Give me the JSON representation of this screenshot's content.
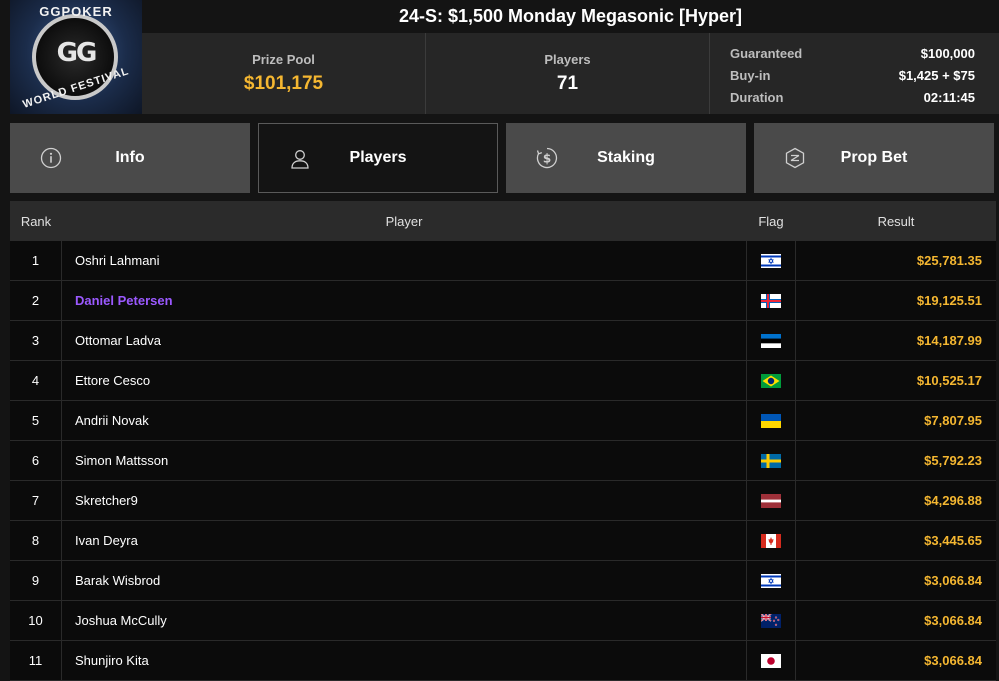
{
  "logo": {
    "top_text": "GGPOKER",
    "bottom_text": "WORLD FESTIVAL",
    "mark": "GG"
  },
  "header": {
    "title": "24-S: $1,500 Monday Megasonic [Hyper]",
    "prize_pool_label": "Prize Pool",
    "prize_pool_value": "$101,175",
    "players_label": "Players",
    "players_value": "71",
    "details": [
      {
        "label": "Guaranteed",
        "value": "$100,000"
      },
      {
        "label": "Buy-in",
        "value": "$1,425 + $75"
      },
      {
        "label": "Duration",
        "value": "02:11:45"
      }
    ]
  },
  "tabs": [
    {
      "label": "Info",
      "icon": "info-icon",
      "active": false
    },
    {
      "label": "Players",
      "icon": "user-icon",
      "active": true
    },
    {
      "label": "Staking",
      "icon": "dollar-icon",
      "active": false
    },
    {
      "label": "Prop Bet",
      "icon": "prop-bet-icon",
      "active": false
    }
  ],
  "table": {
    "headers": {
      "rank": "Rank",
      "player": "Player",
      "flag": "Flag",
      "result": "Result"
    },
    "rows": [
      {
        "rank": "1",
        "player": "Oshri Lahmani",
        "flag": "israel",
        "result": "$25,781.35"
      },
      {
        "rank": "2",
        "player": "Daniel Petersen",
        "flag": "faroe-islands",
        "result": "$19,125.51",
        "highlight": true
      },
      {
        "rank": "3",
        "player": "Ottomar Ladva",
        "flag": "estonia",
        "result": "$14,187.99"
      },
      {
        "rank": "4",
        "player": "Ettore Cesco",
        "flag": "brazil",
        "result": "$10,525.17"
      },
      {
        "rank": "5",
        "player": "Andrii Novak",
        "flag": "ukraine",
        "result": "$7,807.95"
      },
      {
        "rank": "6",
        "player": "Simon Mattsson",
        "flag": "sweden",
        "result": "$5,792.23"
      },
      {
        "rank": "7",
        "player": "Skretcher9",
        "flag": "latvia",
        "result": "$4,296.88"
      },
      {
        "rank": "8",
        "player": "Ivan Deyra",
        "flag": "canada",
        "result": "$3,445.65"
      },
      {
        "rank": "9",
        "player": "Barak Wisbrod",
        "flag": "israel",
        "result": "$3,066.84"
      },
      {
        "rank": "10",
        "player": "Joshua McCully",
        "flag": "new-zealand",
        "result": "$3,066.84"
      },
      {
        "rank": "11",
        "player": "Shunjiro Kita",
        "flag": "japan",
        "result": "$3,066.84"
      }
    ]
  },
  "colors": {
    "gold": "#f5b731",
    "highlight": "#9b59ff",
    "tab": "#4a4a4a",
    "background": "#141414"
  }
}
